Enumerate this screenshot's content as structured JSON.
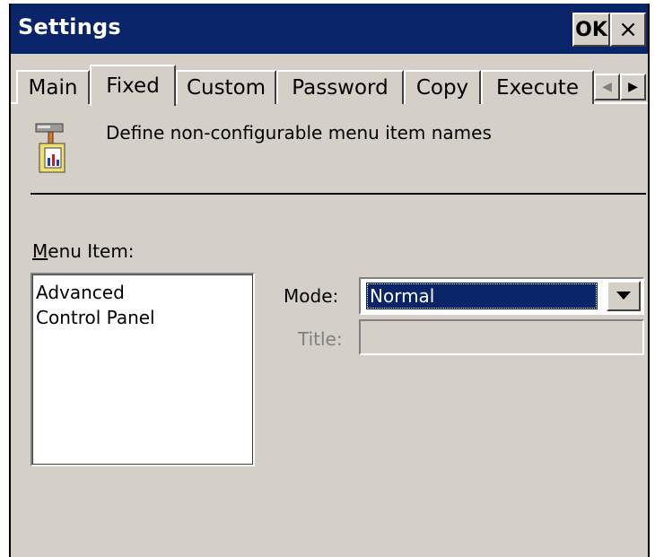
{
  "window": {
    "title": "Settings",
    "ok_label": "OK",
    "close_label": "×"
  },
  "tabs": [
    {
      "label": "Main"
    },
    {
      "label": "Fixed"
    },
    {
      "label": "Custom"
    },
    {
      "label": "Password"
    },
    {
      "label": "Copy"
    },
    {
      "label": "Execute"
    }
  ],
  "tab_scroll": {
    "left": "◀",
    "right": "▶"
  },
  "header": {
    "icon": "settings-hammer-icon",
    "description": "Define non-configurable menu item names"
  },
  "menu_item": {
    "label_accel": "M",
    "label_rest": "enu Item:",
    "items": [
      "Advanced",
      "Control Panel"
    ]
  },
  "mode": {
    "label": "Mode:",
    "value": "Normal"
  },
  "title_field": {
    "label": "Title:",
    "value": ""
  },
  "colors": {
    "titlebar": "#0a246a",
    "face": "#d4d0c8",
    "selection": "#0a246a"
  }
}
